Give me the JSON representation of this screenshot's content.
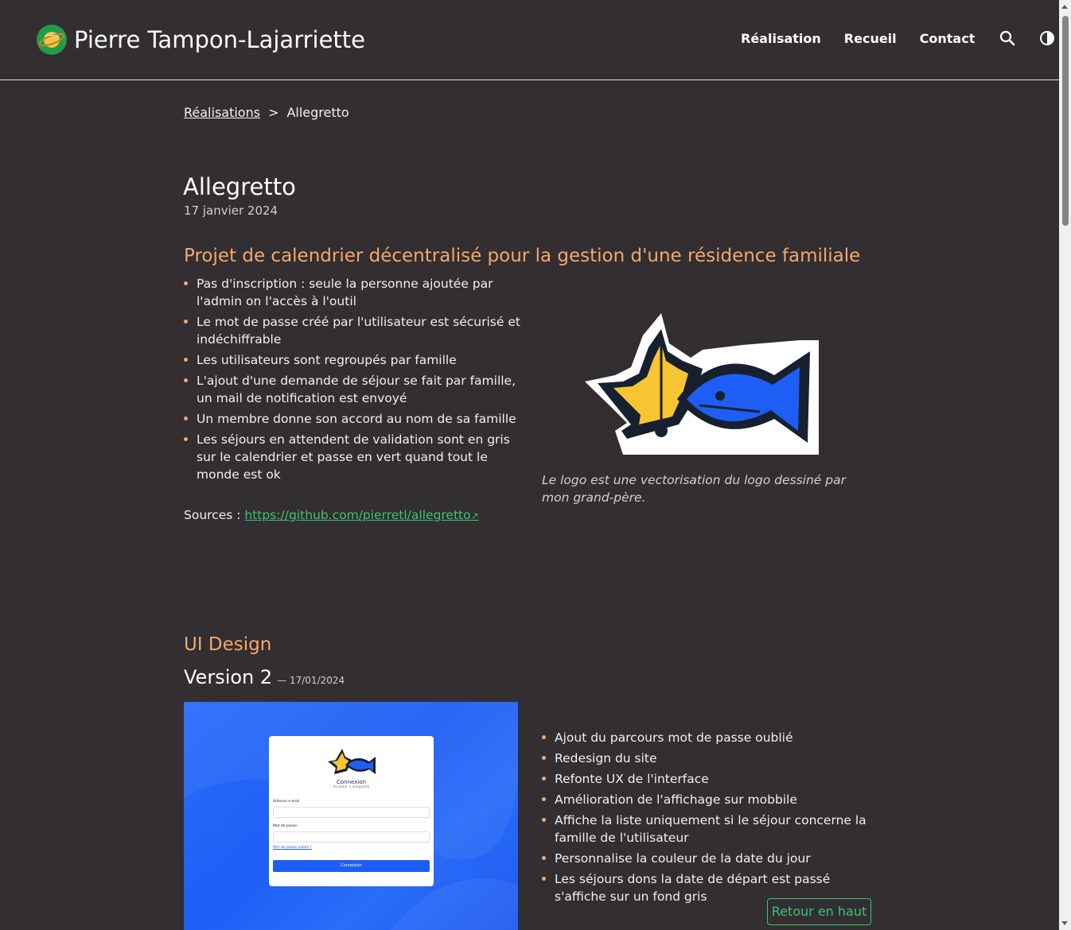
{
  "site": {
    "name": "Pierre Tampon-Lajarriette",
    "logo_icon": "planet-logo-icon"
  },
  "nav": {
    "items": [
      {
        "label": "Réalisation"
      },
      {
        "label": "Recueil"
      },
      {
        "label": "Contact"
      }
    ],
    "search_icon": "search-icon",
    "theme_icon": "contrast-toggle-icon"
  },
  "breadcrumb": {
    "parent": "Réalisations",
    "separator": ">",
    "current": "Allegretto"
  },
  "article": {
    "title": "Allegretto",
    "date": "17 janvier 2024",
    "intro_heading": "Projet de calendrier décentralisé pour la gestion d'une résidence familiale",
    "features": [
      "Pas d'inscription : seule la personne ajoutée par l'admin on l'accès à l'outil",
      "Le mot de passe créé par l'utilisateur est sécurisé et indéchiffrable",
      "Les utilisateurs sont regroupés par famille",
      "L'ajout d'une demande de séjour se fait par famille, un mail de notification est envoyé",
      "Un membre donne son accord au nom de sa famille",
      "Les séjours en attendent de validation sont en gris sur le calendrier et passe en vert quand tout le monde est ok"
    ],
    "sources_label": "Sources :",
    "sources_url": "https://github.com/pierretl/allegretto",
    "external_icon": "↗",
    "logo_caption": "Le logo est une vectorisation du logo dessiné par mon grand-père.",
    "ui_heading": "UI Design",
    "version": {
      "title": "Version 2",
      "date": "— 17/01/2024",
      "changes": [
        "Ajout du parcours mot de passe oublié",
        "Redesign du site",
        "Refonte UX de l'interface",
        "Amélioration de l'affichage sur mobbile",
        "Affiche la liste uniquement si le séjour concerne la famille de l'utilisateur",
        "Personnalise la couleur de la date du jour",
        "Les séjours dons la date de départ est passé s'affiche sur un fond gris"
      ]
    },
    "screenshot": {
      "title": "Connexion",
      "subtitle": "Accéder à allegretto",
      "email_label": "Adresse e-mail",
      "password_label": "Mot de passe",
      "forgot_link": "Mot de passe oublié ?",
      "button": "Connexion"
    }
  },
  "back_to_top": "Retour en haut",
  "colors": {
    "background": "#322e31",
    "accent_orange": "#f3a86a",
    "link_green": "#3cc474",
    "logo_blue": "#1f5ef5",
    "logo_yellow": "#f7c531"
  }
}
